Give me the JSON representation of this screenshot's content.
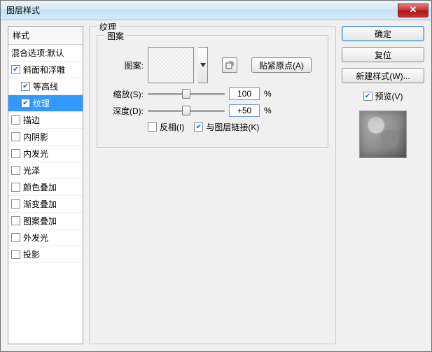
{
  "window": {
    "title": "图层样式"
  },
  "styles": {
    "header": "样式",
    "blending": "混合选项:默认",
    "items": [
      {
        "label": "斜面和浮雕",
        "checked": true,
        "sub": false
      },
      {
        "label": "等高线",
        "checked": true,
        "sub": true
      },
      {
        "label": "纹理",
        "checked": true,
        "sub": true,
        "selected": true
      },
      {
        "label": "描边",
        "checked": false,
        "sub": false
      },
      {
        "label": "内阴影",
        "checked": false,
        "sub": false
      },
      {
        "label": "内发光",
        "checked": false,
        "sub": false
      },
      {
        "label": "光泽",
        "checked": false,
        "sub": false
      },
      {
        "label": "颜色叠加",
        "checked": false,
        "sub": false
      },
      {
        "label": "渐变叠加",
        "checked": false,
        "sub": false
      },
      {
        "label": "图案叠加",
        "checked": false,
        "sub": false
      },
      {
        "label": "外发光",
        "checked": false,
        "sub": false
      },
      {
        "label": "投影",
        "checked": false,
        "sub": false
      }
    ]
  },
  "texture": {
    "group_title": "纹理",
    "pattern_group": "图案",
    "pattern_label": "图案:",
    "snap_origin": "贴紧原点(A)",
    "scale_label": "缩放(S):",
    "scale_value": "100",
    "scale_pct": 50,
    "depth_label": "深度(D):",
    "depth_value": "+50",
    "depth_pct": 50,
    "percent": "%",
    "invert_label": "反相(I)",
    "invert_checked": false,
    "link_label": "与图层链接(K)",
    "link_checked": true
  },
  "buttons": {
    "ok": "确定",
    "reset": "复位",
    "new_style": "新建样式(W)...",
    "preview": "预览(V)",
    "preview_checked": true
  }
}
